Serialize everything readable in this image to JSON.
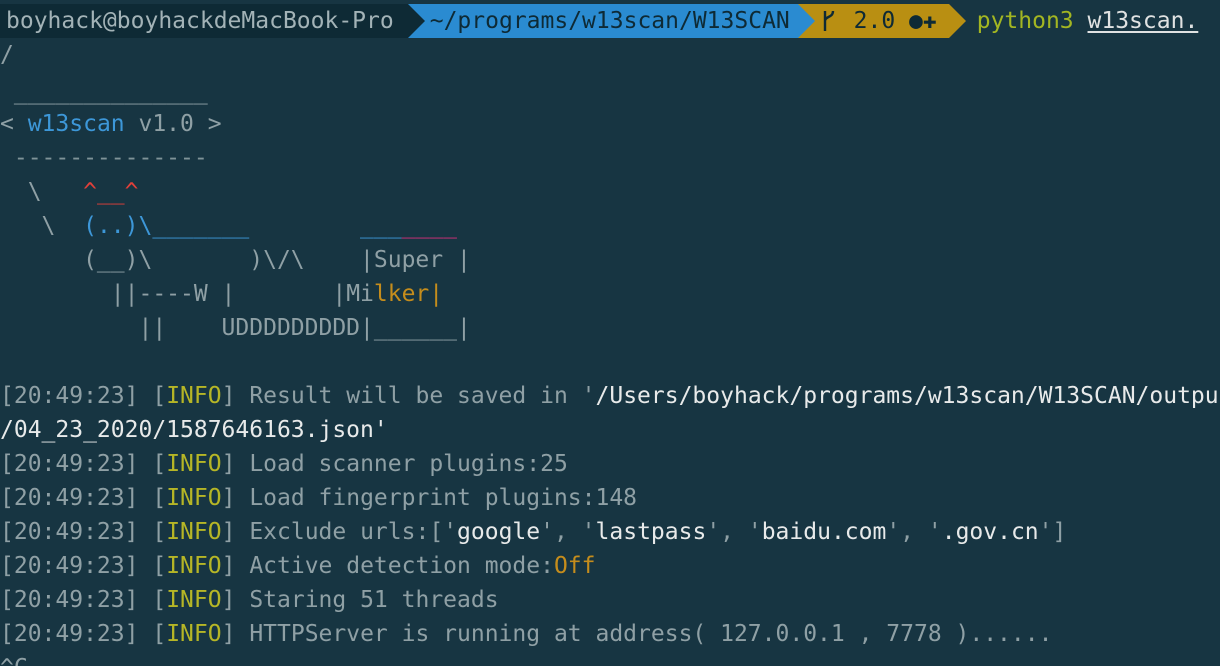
{
  "prompt": {
    "user_host": "boyhack@boyhackdeMacBook-Pro",
    "path": "~/programs/w13scan/W13SCAN",
    "git_branch_icon": "branch-icon",
    "git_branch": "2.0 ●✚",
    "command": "python3",
    "command_arg": "w13scan."
  },
  "banner": {
    "slash_line": "/",
    "top_rule": " ______________",
    "title_open": "< ",
    "title_name": "w13scan",
    "title_rest": " v1.0 >",
    "bottom_rule": " --------------",
    "cow_line1_a": "  \\   ",
    "cow_line1_b": "^__^",
    "cow_line2_a": "   \\  ",
    "cow_line2_b": "(..)\\_______",
    "cow_line2_gap": "        ",
    "cow_line2_c": "___",
    "cow_line2_d": "____",
    "cow_line3_a": "      (__)\\       )\\/\\    |",
    "cow_line3_b": "Super",
    "cow_line3_c": " |",
    "cow_line4_a": "        ||----W |       |",
    "cow_line4_b": "Mi",
    "cow_line4_c": "lker",
    "cow_line4_d": "|",
    "cow_line5": "          ||    UDDDDDDDDD|______|"
  },
  "logs": [
    {
      "time": "[20:49:23]",
      "level": "INFO",
      "msg": "Result will be saved in '",
      "value": "/Users/boyhack/programs/w13scan/W13SCAN/outpu",
      "value_color": "w"
    },
    {
      "continuation": "/04_23_2020/1587646163.json'"
    },
    {
      "time": "[20:49:23]",
      "level": "INFO",
      "msg": "Load scanner plugins:25"
    },
    {
      "time": "[20:49:23]",
      "level": "INFO",
      "msg": "Load fingerprint plugins:148"
    },
    {
      "time": "[20:49:23]",
      "level": "INFO",
      "msg": "Exclude urls:['google', 'lastpass', 'baidu.com', '.gov.cn']"
    },
    {
      "time": "[20:49:23]",
      "level": "INFO",
      "msg": "Active detection mode:",
      "value": "Off",
      "value_color": "orange"
    },
    {
      "time": "[20:49:23]",
      "level": "INFO",
      "msg": "Staring 51 threads"
    },
    {
      "time": "[20:49:23]",
      "level": "INFO",
      "msg": "HTTPServer is running at address( 127.0.0.1 , 7778 )......"
    }
  ],
  "exclude": {
    "prefix": "Exclude urls:[",
    "items": [
      "google",
      "lastpass",
      "baidu.com",
      ".gov.cn"
    ],
    "suffix": "]"
  },
  "bottom_partial": "^C"
}
